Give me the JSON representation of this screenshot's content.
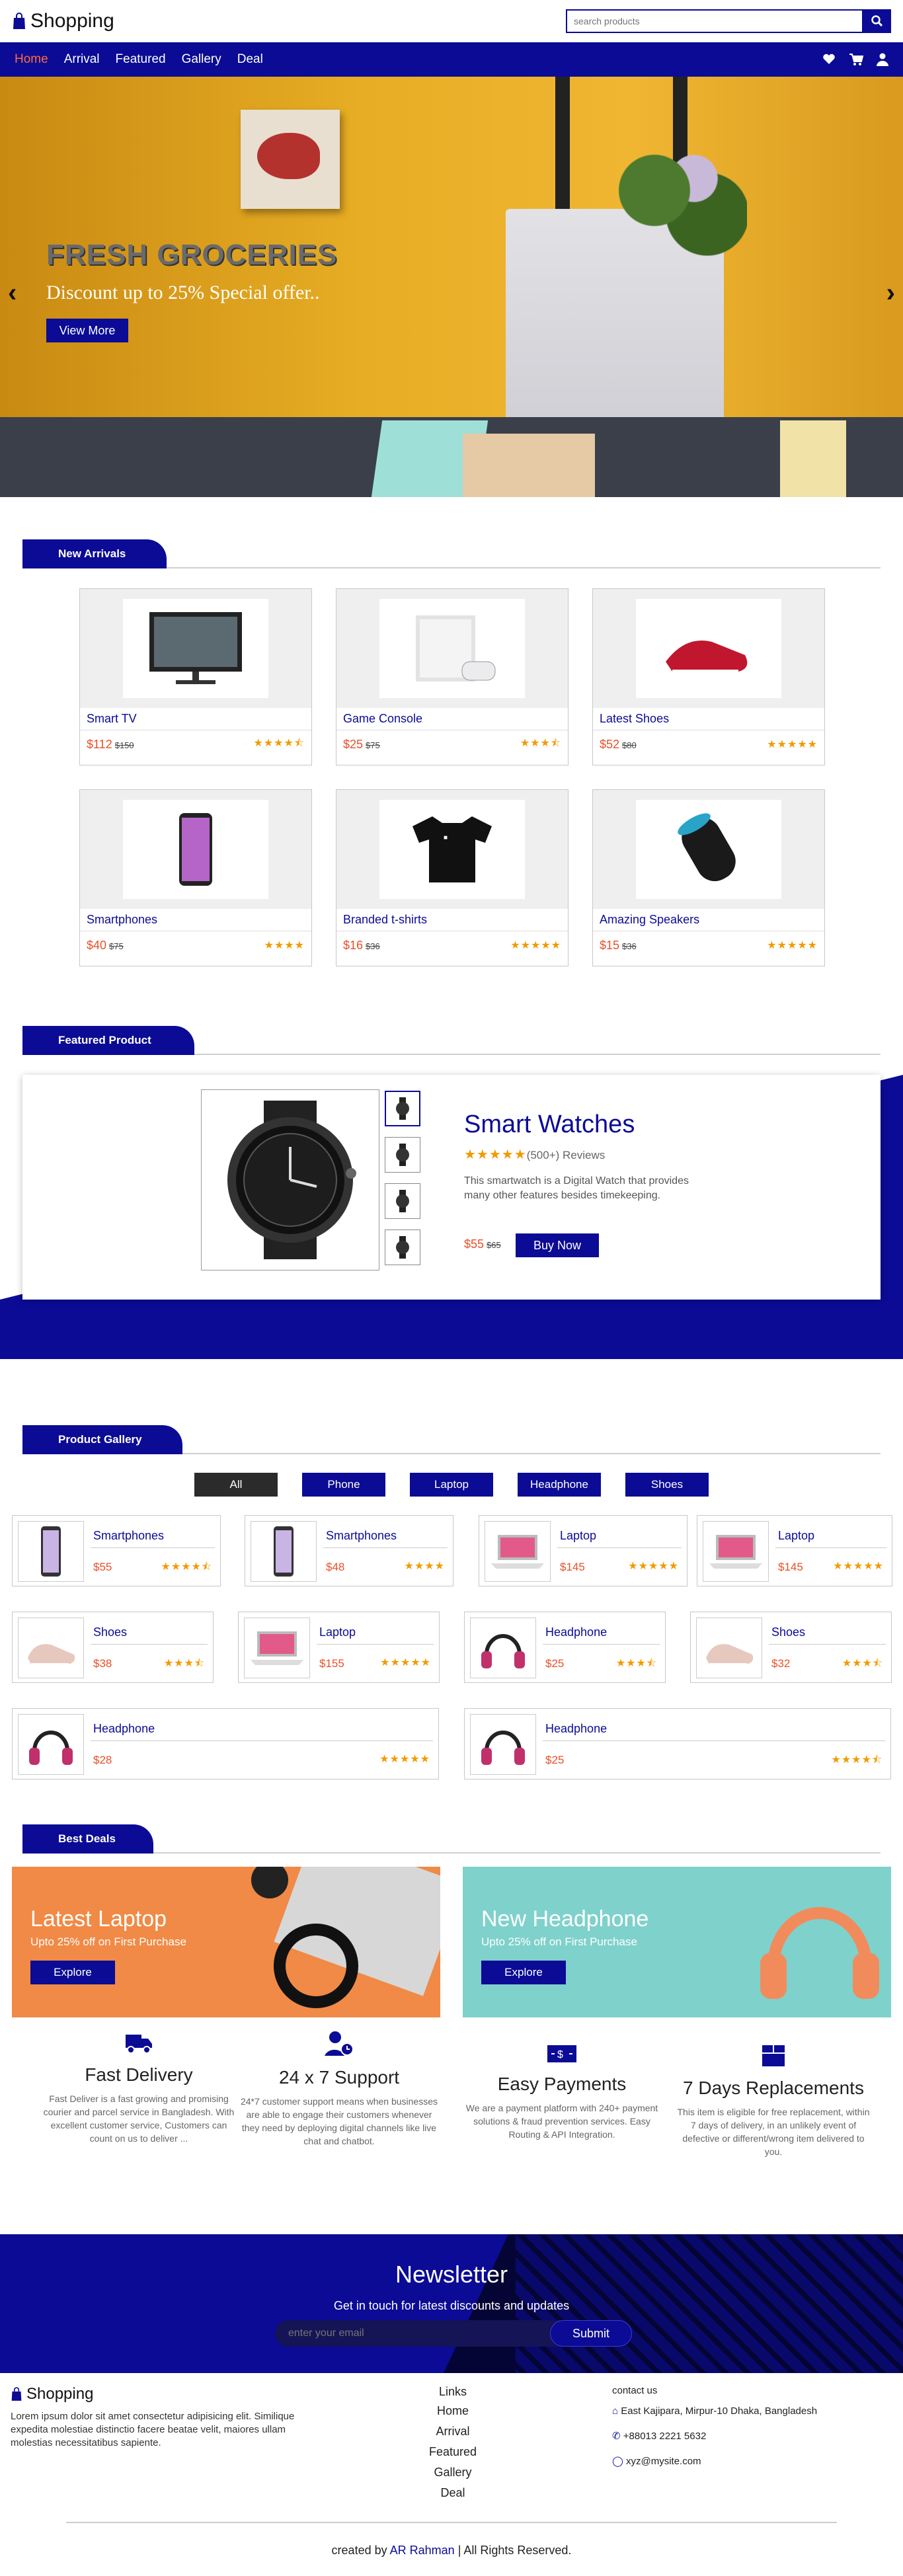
{
  "header": {
    "logo": "Shopping",
    "search_placeholder": "search products"
  },
  "nav": {
    "items": [
      "Home",
      "Arrival",
      "Featured",
      "Gallery",
      "Deal"
    ],
    "active": "Home"
  },
  "hero": {
    "title": "FRESH GROCERIES",
    "subtitle": "Discount up to 25% Special offer..",
    "button": "View More"
  },
  "arrivals": {
    "heading": "New Arrivals",
    "items": [
      {
        "name": "Smart TV",
        "price": "$112",
        "old": "$150",
        "rating": 4.5
      },
      {
        "name": "Game Console",
        "price": "$25",
        "old": "$75",
        "rating": 3.5
      },
      {
        "name": "Latest Shoes",
        "price": "$52",
        "old": "$80",
        "rating": 5
      },
      {
        "name": "Smartphones",
        "price": "$40",
        "old": "$75",
        "rating": 4
      },
      {
        "name": "Branded t-shirts",
        "price": "$16",
        "old": "$36",
        "rating": 5
      },
      {
        "name": "Amazing Speakers",
        "price": "$15",
        "old": "$36",
        "rating": 5
      }
    ]
  },
  "featured": {
    "heading": "Featured Product",
    "title": "Smart Watches",
    "reviews": "(500+) Reviews",
    "rating": 5,
    "description": "This smartwatch is a Digital Watch that provides many other features besides timekeeping.",
    "price": "$55",
    "old": "$65",
    "button": "Buy Now"
  },
  "gallery": {
    "heading": "Product Gallery",
    "filters": [
      "All",
      "Phone",
      "Laptop",
      "Headphone",
      "Shoes"
    ],
    "active_filter": "All",
    "items": [
      {
        "name": "Smartphones",
        "price": "$55",
        "rating": 4.5,
        "icon": "phone"
      },
      {
        "name": "Smartphones",
        "price": "$48",
        "rating": 4,
        "icon": "phone"
      },
      {
        "name": "Laptop",
        "price": "$145",
        "rating": 5,
        "icon": "laptop"
      },
      {
        "name": "Laptop",
        "price": "$145",
        "rating": 5,
        "icon": "laptop"
      },
      {
        "name": "Shoes",
        "price": "$38",
        "rating": 3.5,
        "icon": "shoe"
      },
      {
        "name": "Laptop",
        "price": "$155",
        "rating": 5,
        "icon": "laptop"
      },
      {
        "name": "Headphone",
        "price": "$25",
        "rating": 3.5,
        "icon": "headphone"
      },
      {
        "name": "Shoes",
        "price": "$32",
        "rating": 3.5,
        "icon": "shoe"
      },
      {
        "name": "Headphone",
        "price": "$28",
        "rating": 5,
        "icon": "headphone"
      },
      {
        "name": "Headphone",
        "price": "$25",
        "rating": 4.5,
        "icon": "headphone"
      }
    ]
  },
  "deals": {
    "heading": "Best Deals",
    "items": [
      {
        "title": "Latest Laptop",
        "sub": "Upto 25% off on First Purchase",
        "button": "Explore",
        "color": "#f08a46"
      },
      {
        "title": "New Headphone",
        "sub": "Upto 25% off on First Purchase",
        "button": "Explore",
        "color": "#7fd1cc"
      }
    ]
  },
  "services": [
    {
      "icon": "truck-icon",
      "title": "Fast Delivery",
      "desc": "Fast Deliver is a fast growing and promising courier and parcel service in Bangladesh. With excellent customer service, Customers can count on us to deliver ..."
    },
    {
      "icon": "user-clock-icon",
      "title": "24 x 7 Support",
      "desc": "24*7 customer support means when businesses are able to engage their customers whenever they need by deploying digital channels like live chat and chatbot."
    },
    {
      "icon": "money-icon",
      "title": "Easy Payments",
      "desc": "We are a payment platform with 240+ payment solutions & fraud prevention services. Easy Routing & API Integration."
    },
    {
      "icon": "box-icon",
      "title": "7 Days Replacements",
      "desc": "This item is eligible for free replacement, within 7 days of delivery, in an unlikely event of defective or different/wrong item delivered to you."
    }
  ],
  "newsletter": {
    "title": "Newsletter",
    "subtitle": "Get in touch for latest discounts and updates",
    "placeholder": "enter your email",
    "button": "Submit"
  },
  "footer": {
    "brand": "Shopping",
    "about": "Lorem ipsum dolor sit amet consectetur adipisicing elit. Similique expedita molestiae distinctio facere beatae velit, maiores ullam molestias necessitatibus sapiente.",
    "links_title": "Links",
    "links": [
      "Home",
      "Arrival",
      "Featured",
      "Gallery",
      "Deal"
    ],
    "contact_title": "contact us",
    "address": "East Kajipara, Mirpur-10 Dhaka, Bangladesh",
    "phone": "+88013 2221 5632",
    "email": "xyz@mysite.com",
    "credit_pre": "created by",
    "credit_name": "AR Rahman",
    "credit_post": "| All Rights Reserved."
  },
  "colors": {
    "primary": "#0b0b96",
    "accent": "#e8502a",
    "star": "#f29a00"
  }
}
